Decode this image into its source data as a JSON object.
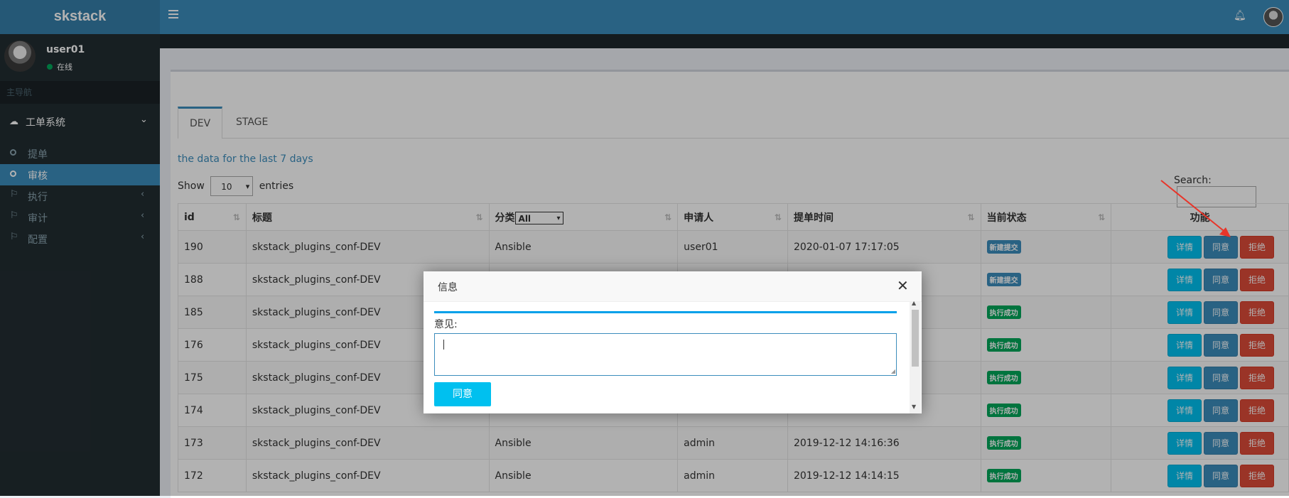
{
  "app": {
    "brand": "skstack"
  },
  "header": {
    "menu_icon": "hamburger-icon",
    "bell_icon": "bell-icon"
  },
  "user": {
    "name": "user01",
    "status": "在线",
    "status_color": "#00a65a"
  },
  "sidebar": {
    "nav_header": "主导航",
    "tree": {
      "label": "工单系统",
      "icon": "cloud-icon"
    },
    "items": [
      {
        "label": "提单",
        "icon": "circle-icon"
      },
      {
        "label": "审核",
        "icon": "circle-icon",
        "active": true
      },
      {
        "label": "执行",
        "icon": "flag-icon"
      },
      {
        "label": "审计",
        "icon": "flag-icon"
      },
      {
        "label": "配置",
        "icon": "flag-icon"
      }
    ]
  },
  "tabs": [
    "DEV",
    "STAGE"
  ],
  "range_text": "the data for the last 7 days",
  "length": {
    "show": "Show",
    "value": "10",
    "entries": "entries"
  },
  "search": {
    "label": "Search:"
  },
  "table": {
    "headers": [
      "id",
      "标题",
      "分类",
      "申请人",
      "提单时间",
      "当前状态",
      "功能"
    ],
    "category_filter": "All",
    "rows": [
      {
        "id": "190",
        "title": "skstack_plugins_conf-DEV",
        "category": "Ansible",
        "applicant": "user01",
        "time": "2020-01-07 17:17:05",
        "status": "新建提交",
        "status_type": "new"
      },
      {
        "id": "188",
        "title": "skstack_plugins_conf-DEV",
        "category": "",
        "applicant": "",
        "time": "",
        "status": "新建提交",
        "status_type": "new"
      },
      {
        "id": "185",
        "title": "skstack_plugins_conf-DEV",
        "category": "",
        "applicant": "",
        "time": "",
        "status": "执行成功",
        "status_type": "ok"
      },
      {
        "id": "176",
        "title": "skstack_plugins_conf-DEV",
        "category": "",
        "applicant": "",
        "time": "",
        "status": "执行成功",
        "status_type": "ok"
      },
      {
        "id": "175",
        "title": "skstack_plugins_conf-DEV",
        "category": "",
        "applicant": "",
        "time": "",
        "status": "执行成功",
        "status_type": "ok"
      },
      {
        "id": "174",
        "title": "skstack_plugins_conf-DEV",
        "category": "",
        "applicant": "",
        "time": "",
        "status": "执行成功",
        "status_type": "ok"
      },
      {
        "id": "173",
        "title": "skstack_plugins_conf-DEV",
        "category": "Ansible",
        "applicant": "admin",
        "time": "2019-12-12 14:16:36",
        "status": "执行成功",
        "status_type": "ok"
      },
      {
        "id": "172",
        "title": "skstack_plugins_conf-DEV",
        "category": "Ansible",
        "applicant": "admin",
        "time": "2019-12-12 14:14:15",
        "status": "执行成功",
        "status_type": "ok"
      }
    ],
    "actions": {
      "detail": "详情",
      "approve": "同意",
      "reject": "拒绝"
    }
  },
  "modal": {
    "title": "信息",
    "label": "意见:",
    "button": "同意",
    "close_icon": "close-icon"
  },
  "colors": {
    "primary": "#3c8dbc",
    "info": "#00c0ef",
    "danger": "#dd4b39",
    "success": "#00a65a",
    "sidebar": "#222d32"
  }
}
